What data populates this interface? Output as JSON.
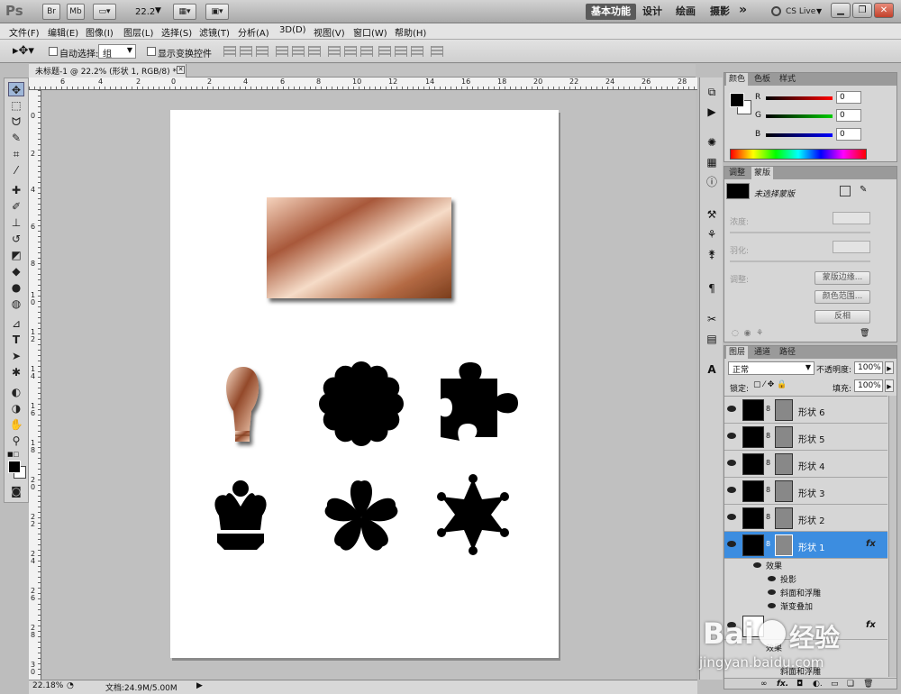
{
  "titlebar": {
    "bridge": "Br",
    "minibridge": "Mb",
    "zoom": "22.2",
    "workspaces": [
      "基本功能",
      "设计",
      "绘画",
      "摄影"
    ],
    "more": "»",
    "cslive": "CS Live"
  },
  "menu": [
    "文件(F)",
    "编辑(E)",
    "图像(I)",
    "图层(L)",
    "选择(S)",
    "滤镜(T)",
    "分析(A)",
    "3D(D)",
    "视图(V)",
    "窗口(W)",
    "帮助(H)"
  ],
  "options": {
    "auto_select_label": "自动选择:",
    "auto_select_value": "组",
    "show_transform_label": "显示变换控件"
  },
  "document": {
    "tab_title": "未标题-1 @ 22.2% (形状 1, RGB/8) *"
  },
  "hruler_labels": [
    "6",
    "4",
    "2",
    "0",
    "2",
    "4",
    "6",
    "8",
    "10",
    "12",
    "14",
    "16",
    "18",
    "20",
    "22",
    "24",
    "26",
    "28"
  ],
  "vruler_labels": [
    "0",
    "2",
    "4",
    "6",
    "8",
    "1\n0",
    "1\n2",
    "1\n4",
    "1\n6",
    "1\n8",
    "2\n0",
    "2\n2",
    "2\n4",
    "2\n6",
    "2\n8",
    "3\n0"
  ],
  "status": {
    "zoom": "22.18%",
    "doc": "文档:24.9M/5.00M"
  },
  "color_panel": {
    "tabs": [
      "颜色",
      "色板",
      "样式"
    ],
    "channels": [
      {
        "name": "R",
        "value": "0"
      },
      {
        "name": "G",
        "value": "0"
      },
      {
        "name": "B",
        "value": "0"
      }
    ]
  },
  "adjust_panel": {
    "tabs": [
      "调整",
      "蒙版"
    ],
    "title": "未选择蒙版",
    "density": "浓度:",
    "feather": "羽化:",
    "refine": "调整:",
    "mask_edge": "蒙版边缘...",
    "color_range": "颜色范围...",
    "invert": "反相"
  },
  "layers_panel": {
    "tabs": [
      "图层",
      "通道",
      "路径"
    ],
    "blend_mode": "正常",
    "opacity_label": "不透明度:",
    "opacity": "100%",
    "lock_label": "锁定:",
    "fill_label": "填充:",
    "fill": "100%",
    "layers": [
      "形状 6",
      "形状 5",
      "形状 4",
      "形状 3",
      "形状 2",
      "形状 1"
    ],
    "fx": "fx",
    "effects_label": "效果",
    "effects": [
      "投影",
      "斜面和浮雕",
      "渐变叠加"
    ],
    "partial_effects": "效果",
    "partial_bevel": "斜面和浮雕"
  },
  "watermark": {
    "text1": "Bai",
    "text2": "经验",
    "url": "jingyan.baidu.com"
  },
  "colors": {
    "accent": "#3c8de0",
    "copper_dark": "#7a3d1c",
    "copper_light": "#f6d6c0"
  }
}
